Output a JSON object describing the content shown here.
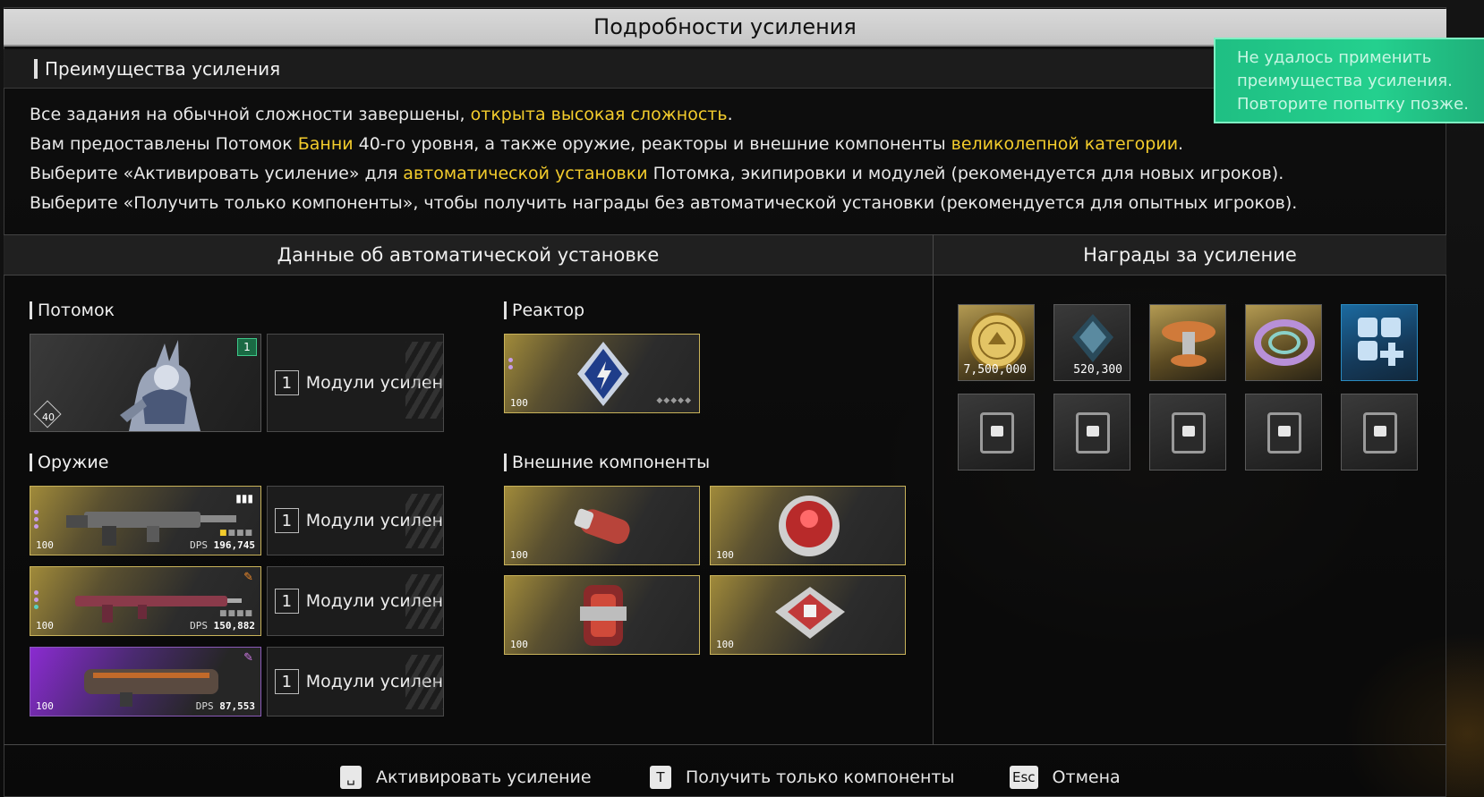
{
  "window": {
    "title": "Подробности усиления"
  },
  "benefits": {
    "heading": "Преимущества усиления",
    "lines": [
      {
        "a": "Все задания на обычной сложности завершены, ",
        "b": "открыта высокая сложность",
        "c": "."
      },
      {
        "a": "Вам предоставлены Потомок ",
        "b": "Банни",
        "c": " 40-го уровня, а также оружие, реакторы и внешние компоненты ",
        "d": "великолепной категории",
        "e": "."
      },
      {
        "a": "Выберите «Активировать усиление» для ",
        "b": "автоматической установки",
        "c": " Потомка, экипировки и модулей (рекомендуется для новых игроков)."
      },
      {
        "a": "Выберите «Получить только компоненты», чтобы получить награды без автоматической установки (рекомендуется для опытных игроков)."
      }
    ]
  },
  "auto_install": {
    "heading": "Данные об автоматической установке",
    "descendant": {
      "label": "Потомок",
      "level": "40",
      "badge": "1",
      "modules_count": "1",
      "modules_label": "Модули усилен"
    },
    "weapons": {
      "label": "Оружие",
      "items": [
        {
          "level": "100",
          "dps_prefix": "DPS",
          "dps": "196,745",
          "modules_count": "1",
          "modules_label": "Модули усилен"
        },
        {
          "level": "100",
          "dps_prefix": "DPS",
          "dps": "150,882",
          "modules_count": "1",
          "modules_label": "Модули усилен"
        },
        {
          "level": "100",
          "dps_prefix": "DPS",
          "dps": "87,553",
          "modules_count": "1",
          "modules_label": "Модули усилен"
        }
      ]
    },
    "reactor": {
      "label": "Реактор",
      "level": "100"
    },
    "external": {
      "label": "Внешние компоненты",
      "levels": [
        "100",
        "100",
        "100",
        "100"
      ]
    }
  },
  "rewards": {
    "heading": "Награды за усиление",
    "items": [
      {
        "icon": "gold-coin-icon",
        "amount": "7,500,000"
      },
      {
        "icon": "crystal-icon",
        "amount": "520,300"
      },
      {
        "icon": "mushroom-device-icon",
        "amount": ""
      },
      {
        "icon": "ring-disc-icon",
        "amount": ""
      },
      {
        "icon": "module-plus-icon",
        "amount": ""
      },
      {
        "icon": "chip-card-icon",
        "amount": ""
      },
      {
        "icon": "chip-card-icon",
        "amount": ""
      },
      {
        "icon": "chip-card-icon",
        "amount": ""
      },
      {
        "icon": "chip-card-icon",
        "amount": ""
      },
      {
        "icon": "chip-card-icon",
        "amount": ""
      }
    ]
  },
  "toast": {
    "line1": "Не удалось применить",
    "line2": "преимущества усиления.",
    "line3": "Повторите попытку позже."
  },
  "footer": {
    "activate": {
      "key": "␣",
      "label": "Активировать усиление"
    },
    "components_only": {
      "key": "T",
      "label": "Получить только компоненты"
    },
    "cancel": {
      "key": "Esc",
      "label": "Отмена"
    }
  },
  "colors": {
    "highlight": "#f3cc2c",
    "toast": "#24d08e",
    "badge": "#1a6a44"
  }
}
